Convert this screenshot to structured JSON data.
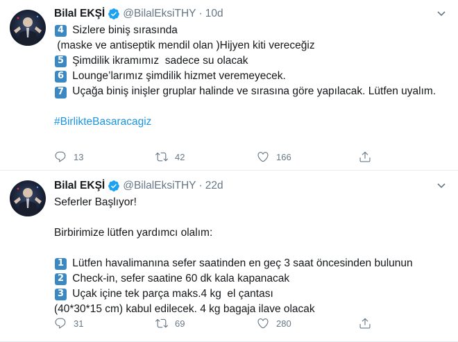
{
  "tweets": [
    {
      "name": "Bilal EKŞİ",
      "handle": "@BilalEksiTHY",
      "separator": "·",
      "time": "10d",
      "lines": [
        {
          "num": "4",
          "text": " Sizlere biniş sırasında"
        },
        {
          "num": "",
          "text": " (maske ve antiseptik mendil olan )Hijyen kiti vereceğiz"
        },
        {
          "num": "5",
          "text": " Şimdilik ikramımız  sadece su olacak"
        },
        {
          "num": "6",
          "text": " Lounge’larımız şimdilik hizmet veremeyecek."
        },
        {
          "num": "7",
          "text": " Uçağa biniş inişler gruplar halinde ve sırasına göre yapılacak. Lütfen uyalım."
        }
      ],
      "hashtag": "#BirlikteBasaracagiz",
      "replies": "13",
      "retweets": "42",
      "likes": "166"
    },
    {
      "name": "Bilal EKŞİ",
      "handle": "@BilalEksiTHY",
      "separator": "·",
      "time": "22d",
      "intro": "Seferler Başlıyor!",
      "intro2": "Birbirimize lütfen yardımcı olalım:",
      "lines": [
        {
          "num": "1",
          "text": " Lütfen havalimanına sefer saatinden en geç 3 saat öncesinden bulunun"
        },
        {
          "num": "2",
          "text": " Check-in, sefer saatine 60 dk kala kapanacak"
        },
        {
          "num": "3",
          "text": " Uçak içine tek parça maks.4 kg  el çantası"
        },
        {
          "num": "",
          "text": "(40*30*15 cm) kabul edilecek. 4 kg bagaja ilave olacak"
        }
      ],
      "replies": "31",
      "retweets": "69",
      "likes": "280"
    }
  ],
  "colors": {
    "accent": "#1b95e0",
    "muted": "#657786",
    "keycap": "#3b88c3",
    "verified": "#1da1f2"
  },
  "icons": [
    "avatar",
    "verified-badge-icon",
    "chevron-down-icon",
    "reply-icon",
    "retweet-icon",
    "like-icon",
    "share-icon"
  ]
}
